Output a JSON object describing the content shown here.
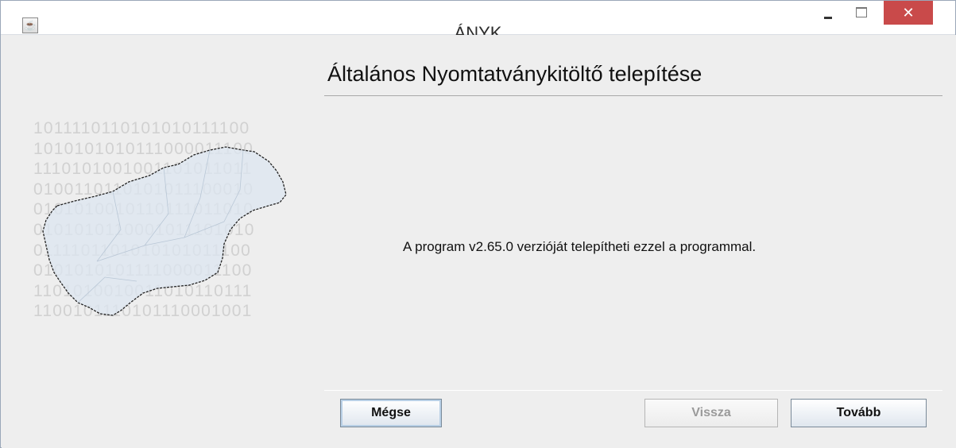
{
  "window": {
    "title": "ÁNYK",
    "close_glyph": "✕"
  },
  "page": {
    "heading": "Általános Nyomtatványkitöltő telepítése",
    "message": "A program v2.65.0 verzióját telepítheti ezzel a programmal."
  },
  "side_art": {
    "binary_lines": [
      "1011110110101010111100",
      "1010101010111000011100",
      "1110101001001101011011",
      "0100110110101011100010",
      "0101010010110111011010",
      "0101010110001011101010",
      "0111101101010101011100",
      "0101010101111000011100",
      "1101010010011010110111",
      "1100101110101110001001"
    ]
  },
  "buttons": {
    "cancel": "Mégse",
    "back": "Vissza",
    "next": "Tovább"
  },
  "icons": {
    "app": "java-icon",
    "minimize": "minimize-icon",
    "maximize": "maximize-icon",
    "close": "close-icon"
  }
}
